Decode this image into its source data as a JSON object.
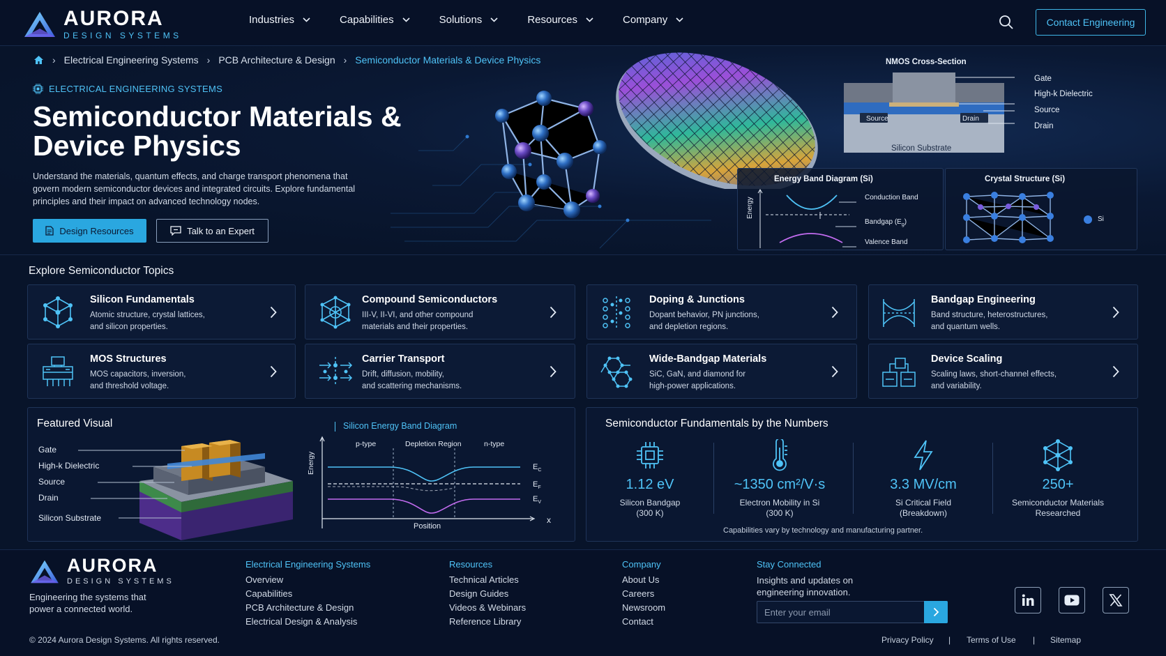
{
  "brand": {
    "name": "AURORA",
    "tagline": "DESIGN SYSTEMS"
  },
  "nav": {
    "items": [
      "Industries",
      "Capabilities",
      "Solutions",
      "Resources",
      "Company"
    ],
    "contact_label": "Contact Engineering"
  },
  "breadcrumb": [
    "Electrical Engineering Systems",
    "PCB Architecture & Design",
    "Semiconductor Materials & Device Physics"
  ],
  "hero": {
    "eyebrow": "ELECTRICAL ENGINEERING SYSTEMS",
    "title": "Semiconductor Materials & Device Physics",
    "description": "Understand the materials, quantum effects, and charge transport phenomena that govern modern semiconductor devices and integrated circuits. Explore fundamental principles and their impact on advanced technology nodes.",
    "primary_button": "Design Resources",
    "secondary_button": "Talk to an Expert"
  },
  "nmos": {
    "title": "NMOS Cross-Section",
    "labels": [
      "Gate",
      "High-k Dielectric",
      "Source",
      "Drain"
    ],
    "source_tag": "Source",
    "drain_tag": "Drain",
    "substrate": "Silicon Substrate"
  },
  "band_panel": {
    "title": "Energy Band Diagram (Si)",
    "axis": "Energy",
    "conduction": "Conduction Band",
    "bandgap": "Bandgap (E",
    "bandgap_sub": "g",
    "bandgap_end": ")",
    "valence": "Valence Band"
  },
  "crystal_panel": {
    "title": "Crystal Structure (Si)",
    "legend": "Si"
  },
  "topics": {
    "title": "Explore Semiconductor Topics",
    "cards": [
      {
        "title": "Silicon Fundamentals",
        "desc1": "Atomic structure, crystal lattices,",
        "desc2": "and silicon properties."
      },
      {
        "title": "Compound Semiconductors",
        "desc1": "III-V, II-VI, and other compound",
        "desc2": "materials and their properties."
      },
      {
        "title": "Doping & Junctions",
        "desc1": "Dopant behavior, PN junctions,",
        "desc2": "and depletion regions."
      },
      {
        "title": "Bandgap Engineering",
        "desc1": "Band structure, heterostructures,",
        "desc2": "and quantum wells."
      },
      {
        "title": "MOS Structures",
        "desc1": "MOS capacitors, inversion,",
        "desc2": "and threshold voltage."
      },
      {
        "title": "Carrier Transport",
        "desc1": "Drift, diffusion, mobility,",
        "desc2": "and scattering mechanisms."
      },
      {
        "title": "Wide-Bandgap Materials",
        "desc1": "SiC, GaN, and diamond for",
        "desc2": "high-power applications."
      },
      {
        "title": "Device Scaling",
        "desc1": "Scaling laws, short-channel effects,",
        "desc2": "and variability."
      }
    ]
  },
  "featured": {
    "title": "Featured Visual",
    "labels": [
      "Gate",
      "High-k Dielectric",
      "Source",
      "Drain",
      "Silicon Substrate"
    ],
    "chart_title": "Silicon Energy Band Diagram",
    "regions": [
      "p-type",
      "Depletion Region",
      "n-type"
    ],
    "ylabel": "Energy",
    "xlabel": "Position",
    "x_arrow": "x",
    "band_labels": {
      "ec": "E",
      "ec_sub": "C",
      "ef": "E",
      "ef_sub": "F",
      "ev": "E",
      "ev_sub": "V"
    }
  },
  "numbers": {
    "title": "Semiconductor Fundamentals by the Numbers",
    "stats": [
      {
        "value": "1.12 eV",
        "label1": "Silicon Bandgap",
        "label2": "(300 K)"
      },
      {
        "value": "~1350 cm²/V·s",
        "label1": "Electron Mobility in Si",
        "label2": "(300 K)"
      },
      {
        "value": "3.3 MV/cm",
        "label1": "Si Critical Field",
        "label2": "(Breakdown)"
      },
      {
        "value": "250+",
        "label1": "Semiconductor Materials",
        "label2": "Researched"
      }
    ],
    "note": "Capabilities vary by technology and manufacturing partner."
  },
  "footer": {
    "tagline1": "Engineering the systems that",
    "tagline2": "power a connected world.",
    "col1": {
      "heading": "Electrical Engineering Systems",
      "links": [
        "Overview",
        "Capabilities",
        "PCB Architecture & Design",
        "Electrical Design & Analysis"
      ]
    },
    "col2": {
      "heading": "Resources",
      "links": [
        "Technical Articles",
        "Design Guides",
        "Videos & Webinars",
        "Reference Library"
      ]
    },
    "col3": {
      "heading": "Company",
      "links": [
        "About Us",
        "Careers",
        "Newsroom",
        "Contact"
      ]
    },
    "connect": {
      "heading": "Stay Connected",
      "line1": "Insights and updates on",
      "line2": "engineering innovation.",
      "placeholder": "Enter your email"
    },
    "copyright": "© 2024 Aurora Design Systems. All rights reserved.",
    "legal": [
      "Privacy Policy",
      "Terms of Use",
      "Sitemap"
    ],
    "social": [
      "linkedin-icon",
      "youtube-icon",
      "x-icon"
    ]
  },
  "colors": {
    "accent": "#4fc3f7",
    "button": "#2aa7e0",
    "background": "#08142a"
  }
}
